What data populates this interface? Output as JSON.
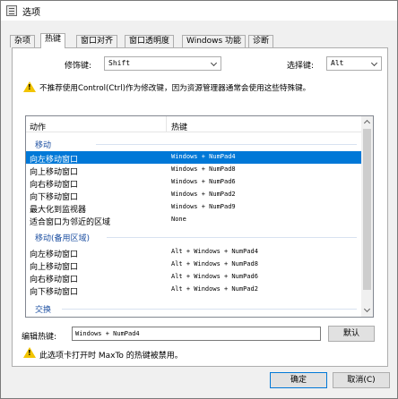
{
  "window": {
    "title": "选项"
  },
  "tabs": [
    "杂项",
    "热键",
    "窗口对齐",
    "窗口透明度",
    "Windows 功能",
    "诊断"
  ],
  "modifier": {
    "label": "修饰键:",
    "value": "Shift"
  },
  "select_key": {
    "label": "选择键:",
    "value": "Alt"
  },
  "warning_top": "不推荐使用Control(Ctrl)作为修改键，因为资源管理器通常会使用这些特殊键。",
  "list": {
    "headers": {
      "action": "动作",
      "hotkey": "热键"
    },
    "groups": [
      {
        "name": "移动",
        "rows": [
          {
            "action": "向左移动窗口",
            "hotkey": "Windows + NumPad4",
            "selected": true
          },
          {
            "action": "向上移动窗口",
            "hotkey": "Windows + NumPad8"
          },
          {
            "action": "向右移动窗口",
            "hotkey": "Windows + NumPad6"
          },
          {
            "action": "向下移动窗口",
            "hotkey": "Windows + NumPad2"
          },
          {
            "action": "最大化到监视器",
            "hotkey": "Windows + NumPad9"
          },
          {
            "action": "适合窗口为邻近的区域",
            "hotkey": "None"
          }
        ]
      },
      {
        "name": "移动(备用区域)",
        "rows": [
          {
            "action": "向左移动窗口",
            "hotkey": "Alt + Windows + NumPad4"
          },
          {
            "action": "向上移动窗口",
            "hotkey": "Alt + Windows + NumPad8"
          },
          {
            "action": "向右移动窗口",
            "hotkey": "Alt + Windows + NumPad6"
          },
          {
            "action": "向下移动窗口",
            "hotkey": "Alt + Windows + NumPad2"
          }
        ]
      },
      {
        "name": "交换",
        "rows": []
      }
    ]
  },
  "edit_hotkey": {
    "label": "编辑热键:",
    "value": "Windows + NumPad4",
    "default_button": "默认"
  },
  "warning_bottom": "此选项卡打开时 MaxTo 的热键被禁用。",
  "buttons": {
    "ok": "确定",
    "cancel": "取消(C)"
  },
  "colors": {
    "selection": "#0078d7",
    "group_header": "#1e50a2",
    "warning": "#f2c400"
  }
}
